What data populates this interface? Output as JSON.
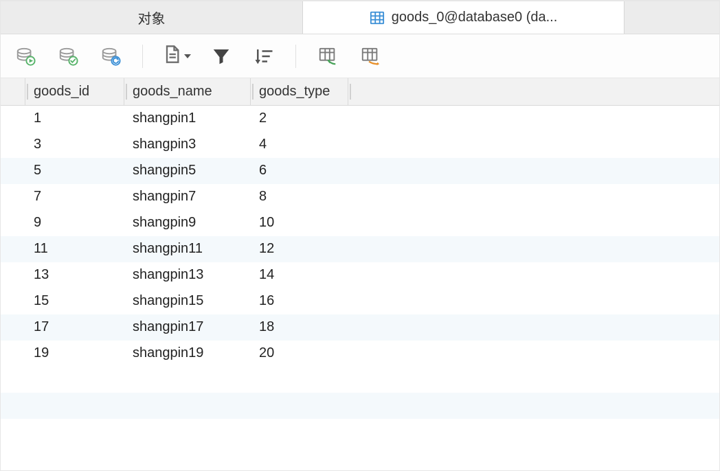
{
  "tabs": {
    "inactive": {
      "label": "对象"
    },
    "active": {
      "label": "goods_0@database0 (da..."
    }
  },
  "toolbar": {
    "icons": {
      "db_play": "db-play-icon",
      "db_check": "db-check-icon",
      "db_refresh": "db-refresh-icon",
      "doc": "document-icon",
      "filter": "filter-icon",
      "sort": "sort-icon",
      "grid_import": "grid-import-icon",
      "grid_export": "grid-export-icon"
    }
  },
  "table": {
    "columns": [
      "goods_id",
      "goods_name",
      "goods_type"
    ],
    "rows": [
      {
        "goods_id": "1",
        "goods_name": "shangpin1",
        "goods_type": "2"
      },
      {
        "goods_id": "3",
        "goods_name": "shangpin3",
        "goods_type": "4"
      },
      {
        "goods_id": "5",
        "goods_name": "shangpin5",
        "goods_type": "6"
      },
      {
        "goods_id": "7",
        "goods_name": "shangpin7",
        "goods_type": "8"
      },
      {
        "goods_id": "9",
        "goods_name": "shangpin9",
        "goods_type": "10"
      },
      {
        "goods_id": "11",
        "goods_name": "shangpin11",
        "goods_type": "12"
      },
      {
        "goods_id": "13",
        "goods_name": "shangpin13",
        "goods_type": "14"
      },
      {
        "goods_id": "15",
        "goods_name": "shangpin15",
        "goods_type": "16"
      },
      {
        "goods_id": "17",
        "goods_name": "shangpin17",
        "goods_type": "18"
      },
      {
        "goods_id": "19",
        "goods_name": "shangpin19",
        "goods_type": "20"
      }
    ]
  }
}
